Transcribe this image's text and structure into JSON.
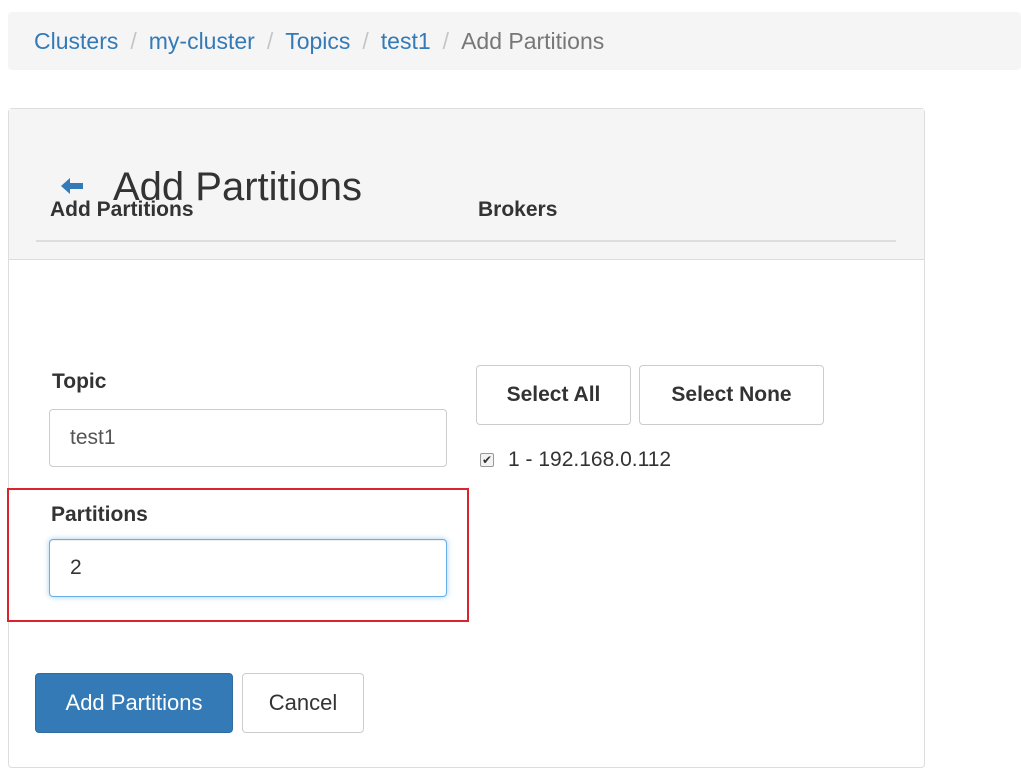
{
  "breadcrumb": {
    "items": [
      "Clusters",
      "my-cluster",
      "Topics",
      "test1"
    ],
    "active": "Add Partitions",
    "separator": "/"
  },
  "panel": {
    "title": "Add Partitions",
    "back_icon": "arrow-left-icon"
  },
  "form": {
    "section_left": "Add Partitions",
    "section_right": "Brokers",
    "topic_label": "Topic",
    "topic_value": "test1",
    "partitions_label": "Partitions",
    "partitions_value": "2",
    "submit_label": "Add Partitions",
    "cancel_label": "Cancel"
  },
  "brokers": {
    "select_all_label": "Select All",
    "select_none_label": "Select None",
    "items": [
      {
        "label": "1 - 192.168.0.112",
        "checked": true
      }
    ]
  },
  "colors": {
    "primary": "#337ab7",
    "highlight": "#d9232d"
  }
}
